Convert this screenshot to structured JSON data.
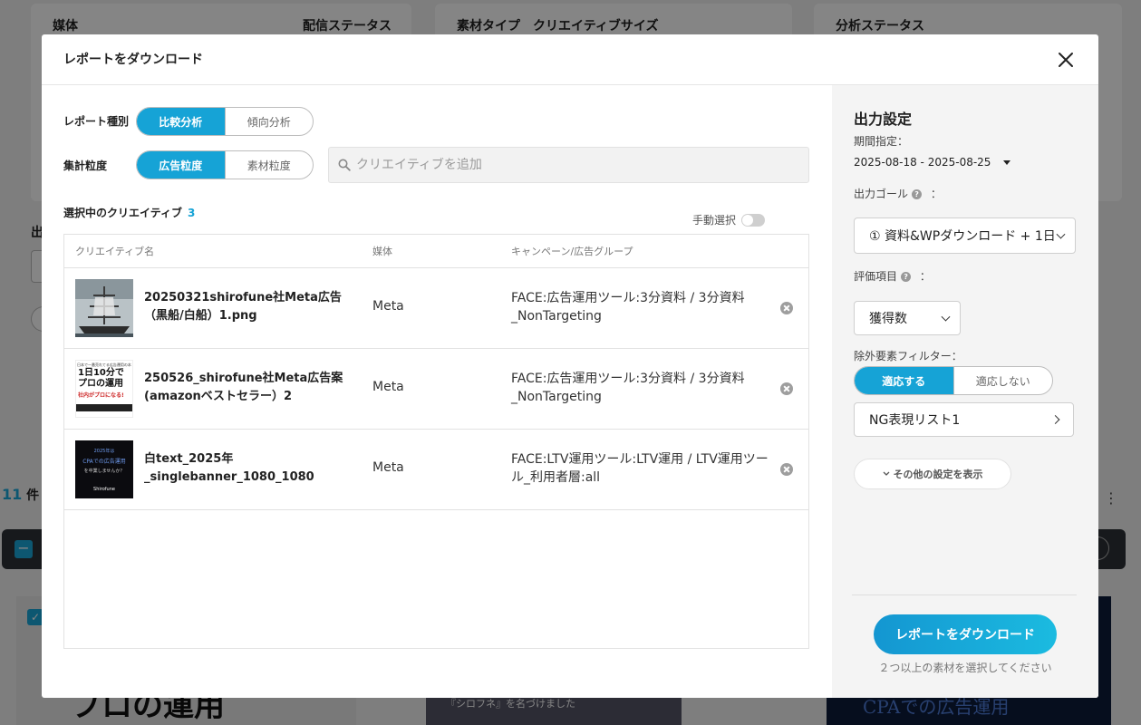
{
  "background": {
    "card_headers": [
      "媒体",
      "配信ステータス",
      "素材タイプ　クリエイティブサイズ",
      "分析ステータス"
    ],
    "left_label": "出",
    "count": "11",
    "count_unit": "件",
    "thumb1_text": "プロの運用",
    "thumb2_caption": "『シロフネ』を名づけました",
    "thumb3_caption": "CPAでの広告運用"
  },
  "modal": {
    "title": "レポートをダウンロード",
    "report_type": {
      "label": "レポート種別",
      "options": [
        "比較分析",
        "傾向分析"
      ],
      "selected": 0
    },
    "granularity": {
      "label": "集計粒度",
      "options": [
        "広告粒度",
        "素材粒度"
      ],
      "selected": 0
    },
    "search": {
      "placeholder": "クリエイティブを追加"
    },
    "selected": {
      "label": "選択中のクリエイティブ",
      "count": "3"
    },
    "manual_select": {
      "label": "手動選択",
      "on": false
    },
    "table": {
      "headers": [
        "クリエイティブ名",
        "媒体",
        "キャンペーン/広告グループ"
      ],
      "rows": [
        {
          "name": "20250321shirofune社Meta広告（黒船/白船）1.png",
          "media": "Meta",
          "campaign": "FACE:広告運用ツール:3分資料 / 3分資料_NonTargeting"
        },
        {
          "name": "250526_shirofune社Meta広告案(amazonベストセラー）2",
          "media": "Meta",
          "campaign": "FACE:広告運用ツール:3分資料 / 3分資料_NonTargeting"
        },
        {
          "name": "白text_2025年_singlebanner_1080_1080",
          "media": "Meta",
          "campaign": "FACE:LTV運用ツール:LTV運用 / LTV運用ツール_利用者層:all"
        }
      ]
    },
    "thumbs": {
      "t2_line1": "日本で一番売れてる広告運用の本",
      "t2_big1": "1日10分で",
      "t2_big2": "プロの運用",
      "t2_big3": "社内がプロになる!",
      "t3_line1": "2025年は",
      "t3_line2": "CPAでの広告運用",
      "t3_line3": "を卒業しませんか？",
      "t3_logo": "Shirofune"
    }
  },
  "output": {
    "title": "出力設定",
    "period_label": "期間指定：",
    "period_value": "2025-08-18 - 2025-08-25",
    "goal_label": "出力ゴール",
    "goal_value": "① 資料&WPダウンロード + 1日",
    "metric_label": "評価項目",
    "metric_value": "獲得数",
    "exclude_label": "除外要素フィルター：",
    "exclude_options": [
      "適応する",
      "適応しない"
    ],
    "exclude_selected": 0,
    "ng_list": "NG表現リスト1",
    "more_settings": "その他の設定を表示",
    "download_button": "レポートをダウンロード",
    "note": "２つ以上の素材を選択してください",
    "colon": "："
  },
  "colors": {
    "accent": "#16a3d6",
    "overlay": "rgba(0,0,0,0.48)"
  }
}
